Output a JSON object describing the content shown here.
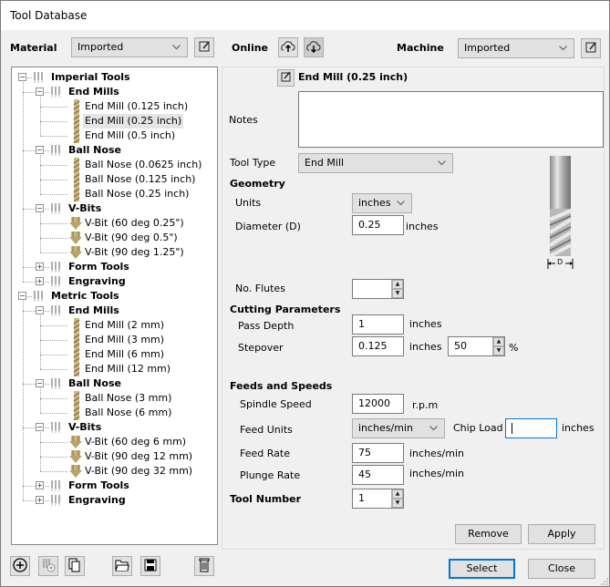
{
  "window": {
    "title": "Tool Database"
  },
  "toolbar": {
    "material_label": "Material",
    "material_value": "Imported",
    "online_label": "Online",
    "machine_label": "Machine",
    "machine_value": "Imported"
  },
  "tree": {
    "groups": [
      {
        "label": "Imperial Tools",
        "expanded": true,
        "categories": [
          {
            "label": "End Mills",
            "expanded": true,
            "icon": "end-mill-icon",
            "items": [
              "End Mill (0.125 inch)",
              "End Mill (0.25 inch)",
              "End Mill (0.5 inch)"
            ]
          },
          {
            "label": "Ball Nose",
            "expanded": true,
            "icon": "ball-nose-icon",
            "items": [
              "Ball Nose (0.0625 inch)",
              "Ball Nose (0.125 inch)",
              "Ball Nose (0.25 inch)"
            ]
          },
          {
            "label": "V-Bits",
            "expanded": true,
            "icon": "v-bit-icon",
            "items": [
              "V-Bit (60 deg 0.25\")",
              "V-Bit (90 deg 0.5\")",
              "V-Bit (90 deg 1.25\")"
            ]
          },
          {
            "label": "Form Tools",
            "expanded": false,
            "items": []
          },
          {
            "label": "Engraving",
            "expanded": false,
            "items": []
          }
        ]
      },
      {
        "label": "Metric Tools",
        "expanded": true,
        "categories": [
          {
            "label": "End Mills",
            "expanded": true,
            "icon": "end-mill-icon",
            "items": [
              "End Mill (2 mm)",
              "End Mill (3 mm)",
              "End Mill (6 mm)",
              "End Mill (12 mm)"
            ]
          },
          {
            "label": "Ball Nose",
            "expanded": true,
            "icon": "ball-nose-icon",
            "items": [
              "Ball Nose (3 mm)",
              "Ball Nose (6 mm)"
            ]
          },
          {
            "label": "V-Bits",
            "expanded": true,
            "icon": "v-bit-icon",
            "items": [
              "V-Bit (60 deg 6 mm)",
              "V-Bit (90 deg 12 mm)",
              "V-Bit (90 deg 32 mm)"
            ]
          },
          {
            "label": "Form Tools",
            "expanded": false,
            "items": []
          },
          {
            "label": "Engraving",
            "expanded": false,
            "items": []
          }
        ]
      }
    ],
    "selected": "End Mill (0.25 inch)"
  },
  "details": {
    "tool_name": "End Mill (0.25 inch)",
    "notes_label": "Notes",
    "notes_value": "",
    "tool_type_label": "Tool Type",
    "tool_type_value": "End Mill",
    "geometry": {
      "heading": "Geometry",
      "units_label": "Units",
      "units_value": "inches",
      "diameter_label": "Diameter (D)",
      "diameter_value": "0.25",
      "diameter_unit": "inches",
      "flutes_label": "No. Flutes",
      "flutes_value": "",
      "diagram_label": "D"
    },
    "cutting": {
      "heading": "Cutting Parameters",
      "pass_depth_label": "Pass Depth",
      "pass_depth_value": "1",
      "pass_depth_unit": "inches",
      "stepover_label": "Stepover",
      "stepover_value": "0.125",
      "stepover_unit": "inches",
      "stepover_percent": "50",
      "percent_sign": "%"
    },
    "feeds": {
      "heading": "Feeds and Speeds",
      "spindle_label": "Spindle Speed",
      "spindle_value": "12000",
      "spindle_unit": "r.p.m",
      "feed_units_label": "Feed Units",
      "feed_units_value": "inches/min",
      "chip_load_label": "Chip Load",
      "chip_load_value": "",
      "chip_load_unit": "inches",
      "feed_rate_label": "Feed Rate",
      "feed_rate_value": "75",
      "feed_rate_unit": "inches/min",
      "plunge_rate_label": "Plunge Rate",
      "plunge_rate_value": "45",
      "plunge_rate_unit": "inches/min"
    },
    "tool_number_label": "Tool Number",
    "tool_number_value": "1",
    "remove_label": "Remove",
    "apply_label": "Apply"
  },
  "footer": {
    "select_label": "Select",
    "close_label": "Close"
  },
  "colors": {
    "accent": "#0078d7",
    "tool_gold": "#c8b27a"
  }
}
